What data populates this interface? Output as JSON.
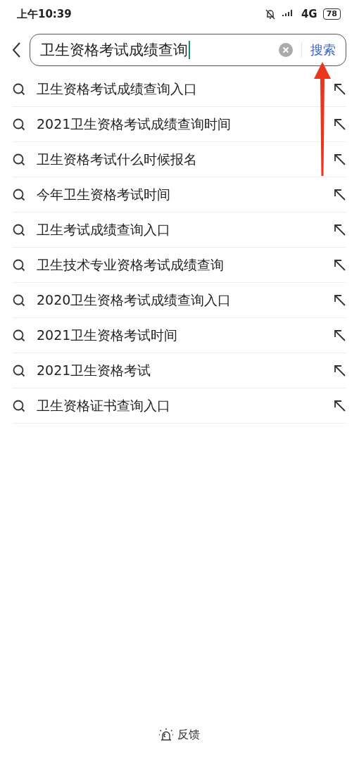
{
  "status_bar": {
    "time": "上午10:39",
    "network": "4G",
    "battery": "78"
  },
  "search": {
    "value": "卫生资格考试成绩查询",
    "button": "搜索"
  },
  "suggestions": [
    {
      "text": "卫生资格考试成绩查询入口"
    },
    {
      "text": "2021卫生资格考试成绩查询时间"
    },
    {
      "text": "卫生资格考试什么时候报名"
    },
    {
      "text": "今年卫生资格考试时间"
    },
    {
      "text": "卫生考试成绩查询入口"
    },
    {
      "text": "卫生技术专业资格考试成绩查询"
    },
    {
      "text": "2020卫生资格考试成绩查询入口"
    },
    {
      "text": "2021卫生资格考试时间"
    },
    {
      "text": "2021卫生资格考试"
    },
    {
      "text": "卫生资格证书查询入口"
    }
  ],
  "footer": {
    "feedback": "反馈"
  }
}
